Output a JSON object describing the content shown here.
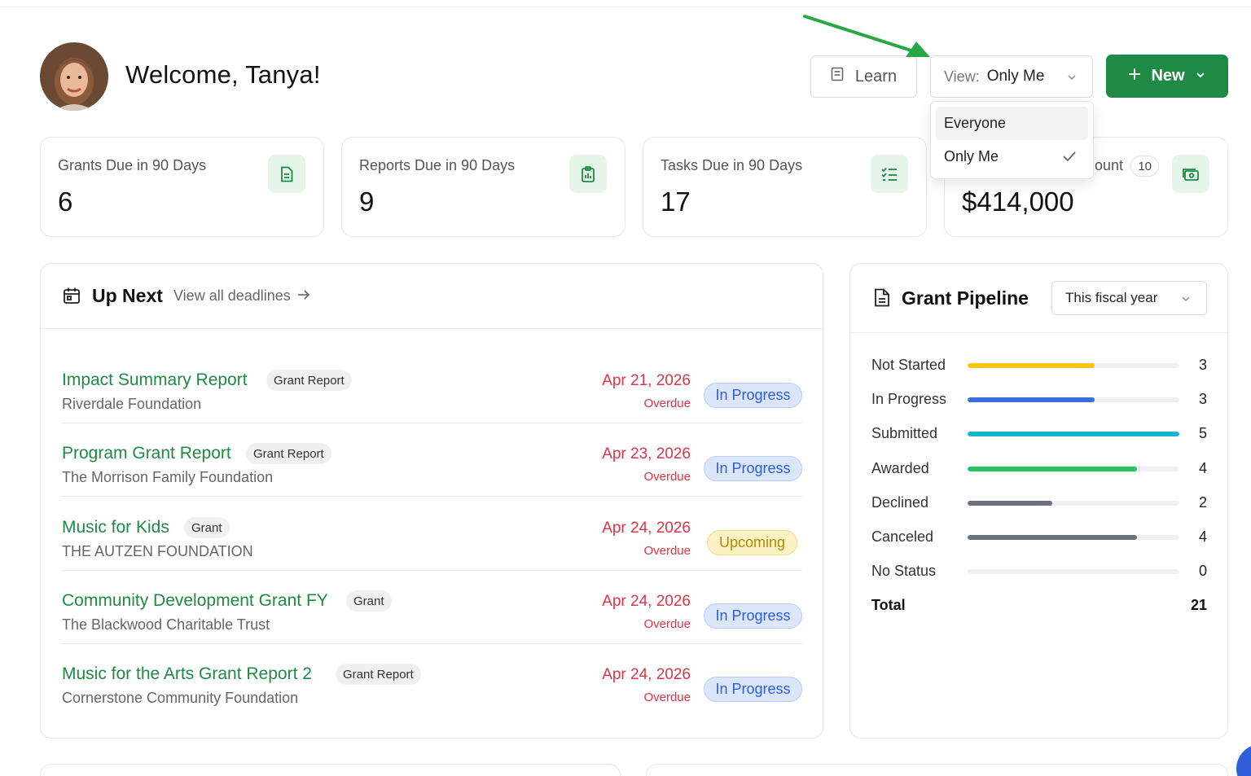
{
  "header": {
    "welcome": "Welcome, Tanya!",
    "learn_label": "Learn",
    "view_label": "View:",
    "view_value": "Only Me",
    "new_label": "New",
    "view_options": [
      {
        "label": "Everyone",
        "selected": false
      },
      {
        "label": "Only Me",
        "selected": true
      }
    ]
  },
  "stats": [
    {
      "label": "Grants Due in 90 Days",
      "value": "6",
      "icon": "document-icon"
    },
    {
      "label": "Reports Due in 90 Days",
      "value": "9",
      "icon": "clipboard-chart-icon"
    },
    {
      "label": "Tasks Due in 90 Days",
      "value": "17",
      "icon": "checklist-icon"
    },
    {
      "label": "ount",
      "badge": "10",
      "value": "$414,000",
      "icon": "money-icon"
    }
  ],
  "up_next": {
    "title": "Up Next",
    "link": "View all deadlines",
    "items": [
      {
        "name": "Impact Summary Report",
        "tag": "Grant Report",
        "org": "Riverdale Foundation",
        "date": "Apr 21, 2026",
        "due": "Overdue",
        "status": "In Progress"
      },
      {
        "name": "Program Grant Report",
        "tag": "Grant Report",
        "org": "The Morrison Family Foundation",
        "date": "Apr 23, 2026",
        "due": "Overdue",
        "status": "In Progress"
      },
      {
        "name": "Music for Kids",
        "tag": "Grant",
        "org": "THE AUTZEN FOUNDATION",
        "date": "Apr 24, 2026",
        "due": "Overdue",
        "status": "Upcoming"
      },
      {
        "name": "Community Development Grant FY",
        "tag": "Grant",
        "org": "The Blackwood Charitable Trust",
        "date": "Apr 24, 2026",
        "due": "Overdue",
        "status": "In Progress"
      },
      {
        "name": "Music for the Arts Grant Report 2",
        "tag": "Grant Report",
        "org": "Cornerstone Community Foundation",
        "date": "Apr 24, 2026",
        "due": "Overdue",
        "status": "In Progress"
      }
    ]
  },
  "pipeline": {
    "title": "Grant Pipeline",
    "period": "This fiscal year",
    "max": 5,
    "rows": [
      {
        "label": "Not Started",
        "value": 3,
        "color": "#f5c518"
      },
      {
        "label": "In Progress",
        "value": 3,
        "color": "#3b6fe0"
      },
      {
        "label": "Submitted",
        "value": 5,
        "color": "#13b5cf"
      },
      {
        "label": "Awarded",
        "value": 4,
        "color": "#22c55e"
      },
      {
        "label": "Declined",
        "value": 2,
        "color": "#6b7280"
      },
      {
        "label": "Canceled",
        "value": 4,
        "color": "#6b7280"
      },
      {
        "label": "No Status",
        "value": 0,
        "color": "#6b7280"
      }
    ],
    "total_label": "Total",
    "total_value": "21"
  },
  "colors": {
    "brand": "#1e8a43",
    "overdue": "#dc3545",
    "arrow": "#28a745"
  }
}
